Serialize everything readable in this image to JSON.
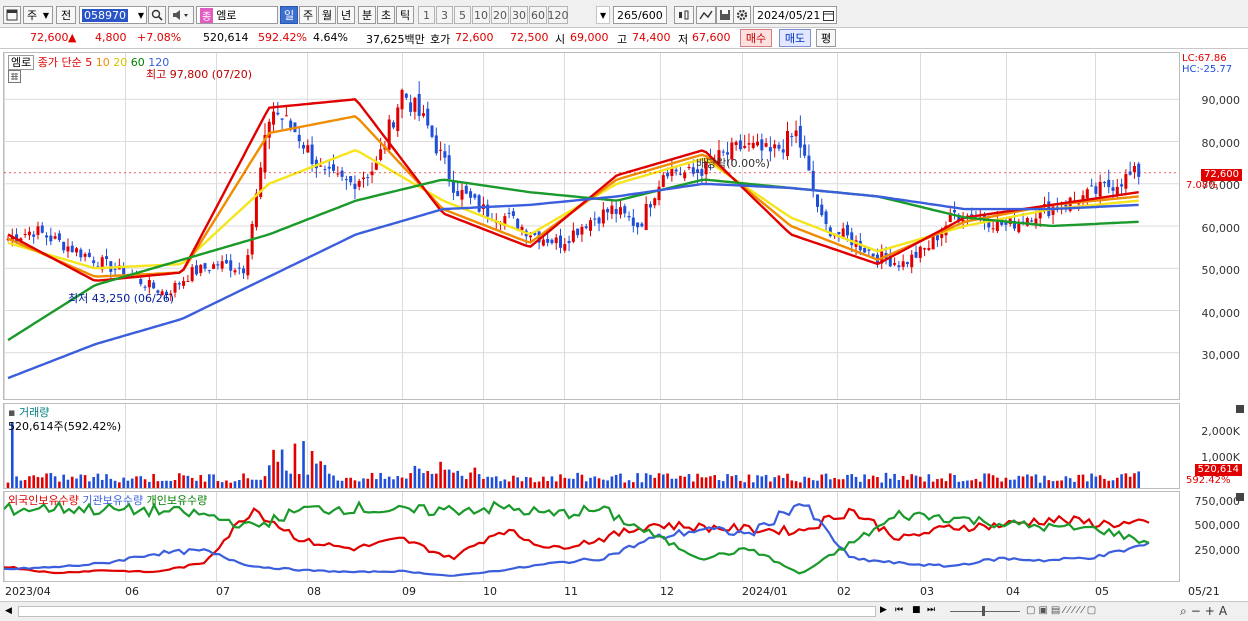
{
  "toolbar": {
    "period_button": "주",
    "prev_label": "전",
    "code_value": "058970",
    "stock_name": "엠로",
    "stock_tag": "종",
    "periods": [
      "일",
      "주",
      "월",
      "년",
      "분",
      "초",
      "틱"
    ],
    "active_period": "일",
    "intervals": [
      "1",
      "3",
      "5",
      "10",
      "20",
      "30",
      "60",
      "120"
    ],
    "count_value": "265",
    "count_total": "/600",
    "date_value": "2024/05/21"
  },
  "quote": {
    "price": "72,600",
    "change_arrow": "▲",
    "change": "4,800",
    "change_pct": "+7.08%",
    "volume": "520,614",
    "volume_ratio": "592.42%",
    "turnover_pct": "4.64%",
    "trade_amount": "37,625백만",
    "bid_label": "호가",
    "ask_price": "72,600",
    "bid_price": "72,500",
    "open_label": "시",
    "open": "69,000",
    "high_label": "고",
    "high": "74,400",
    "low_label": "저",
    "low": "67,600",
    "buy_label": "매수",
    "sell_label": "매도",
    "eval_label": "평"
  },
  "price_panel": {
    "name": "엠로",
    "legend_prefix": "종가 단순",
    "ma_labels": [
      "5",
      "10",
      "20",
      "60",
      "120"
    ],
    "high_note": "최고 97,800 (07/20)",
    "low_note": "최저 43,250 (06/26)",
    "ex_div_note": "배당락(0.00%)",
    "lc": "LC:67.86",
    "hc": "HC:-25.77",
    "current_badge": "72,600",
    "current_pct": "7.08%",
    "y_ticks": [
      "90,000",
      "80,000",
      "70,000",
      "60,000",
      "50,000",
      "40,000",
      "30,000"
    ]
  },
  "volume_panel": {
    "title": "거래량",
    "value_note": "520,614주(592.42%)",
    "y_ticks": [
      "2,000K",
      "1,000K"
    ],
    "badge": "520,614",
    "badge_pct": "592.42%"
  },
  "holdings_panel": {
    "legend": [
      "외국인보유수량",
      "기관보유수량",
      "개인보유수량"
    ],
    "y_ticks": [
      "750,000",
      "500,000",
      "250,000"
    ]
  },
  "x_axis": [
    "2023/04",
    "06",
    "07",
    "08",
    "09",
    "10",
    "11",
    "12",
    "2024/01",
    "02",
    "03",
    "04",
    "05"
  ],
  "x_axis_right": "05/21",
  "colors": {
    "up": "#e00000",
    "down": "#1f4fd8",
    "ma5": "#e00000",
    "ma10": "#f08c00",
    "ma20": "#f5e51a",
    "ma60": "#1a9a2a",
    "ma120": "#3b5fdc",
    "foreign": "#e00000",
    "institution": "#3b5fdc",
    "individual": "#1a9a2a"
  },
  "chart_data": {
    "type": "line",
    "title": "엠로",
    "x": [
      "2023/04",
      "06",
      "07",
      "08",
      "09",
      "10",
      "11",
      "12",
      "2024/01",
      "02",
      "03",
      "04",
      "05",
      "05/21"
    ],
    "series": [
      {
        "name": "5",
        "values": [
          58000,
          47000,
          49000,
          88000,
          90000,
          63000,
          55000,
          72000,
          78000,
          58000,
          51000,
          62000,
          65000,
          68000
        ]
      },
      {
        "name": "10",
        "values": [
          57000,
          48000,
          49000,
          82000,
          86000,
          64000,
          56000,
          71000,
          77000,
          60000,
          52000,
          61000,
          65000,
          67000
        ]
      },
      {
        "name": "20",
        "values": [
          56000,
          50000,
          51000,
          70000,
          78000,
          66000,
          58000,
          70000,
          76000,
          62000,
          54000,
          60000,
          64000,
          66000
        ]
      },
      {
        "name": "60",
        "values": [
          33000,
          46000,
          52000,
          58000,
          66000,
          71000,
          68000,
          66000,
          71000,
          69000,
          67000,
          62000,
          60000,
          61000
        ]
      },
      {
        "name": "120",
        "values": [
          24000,
          32000,
          38000,
          48000,
          58000,
          64000,
          65000,
          67000,
          70000,
          69000,
          67000,
          64000,
          64000,
          65000
        ]
      }
    ],
    "ylim": [
      20000,
      100000
    ],
    "current": 72600,
    "grid": true
  }
}
